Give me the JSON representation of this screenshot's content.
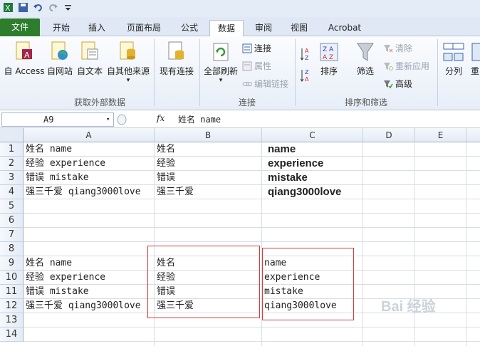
{
  "tabs": {
    "file": "文件",
    "home": "开始",
    "insert": "插入",
    "layout": "页面布局",
    "formulas": "公式",
    "data": "数据",
    "review": "审阅",
    "view": "视图",
    "acrobat": "Acrobat"
  },
  "ribbon": {
    "get_external": {
      "access": "自 Access",
      "web": "自网站",
      "text": "自文本",
      "other": "自其他来源",
      "existing": "现有连接",
      "group": "获取外部数据"
    },
    "connections": {
      "refresh_all": "全部刷新",
      "connections": "连接",
      "properties": "属性",
      "edit_links": "编辑链接",
      "group": "连接"
    },
    "sort_filter": {
      "sort": "排序",
      "filter": "筛选",
      "clear": "清除",
      "reapply": "重新应用",
      "advanced": "高级",
      "group": "排序和筛选"
    },
    "tools": {
      "split": "分列",
      "remove_dup": "重"
    }
  },
  "formula_bar": {
    "name_box": "A9",
    "fx": "fx",
    "value": "姓名 name"
  },
  "columns": [
    "A",
    "B",
    "C",
    "D",
    "E"
  ],
  "rows": [
    "1",
    "2",
    "3",
    "4",
    "5",
    "6",
    "7",
    "8",
    "9",
    "10",
    "11",
    "12",
    "13",
    "14"
  ],
  "cells": {
    "a1": "姓名 name",
    "b1": "姓名",
    "c1": "name",
    "a2": "经验 experience",
    "b2": "经验",
    "c2": "experience",
    "a3": "错误 mistake",
    "b3": "错误",
    "c3": "mistake",
    "a4": "强三千爱 qiang3000love",
    "b4": "强三千爱",
    "c4": "qiang3000love",
    "a9": "姓名 name",
    "b9": "姓名",
    "c9": "name",
    "a10": "经验 experience",
    "b10": "经验",
    "c10": "experience",
    "a11": "错误 mistake",
    "b11": "错误",
    "c11": "mistake",
    "a12": "强三千爱 qiang3000love",
    "b12": "强三千爱",
    "c12": "qiang3000love"
  },
  "watermark": "Bai 经验",
  "colors": {
    "file_tab": "#2d7d2d",
    "highlight_box": "#d63a3a",
    "ribbon_bg": "#e7eef8"
  }
}
